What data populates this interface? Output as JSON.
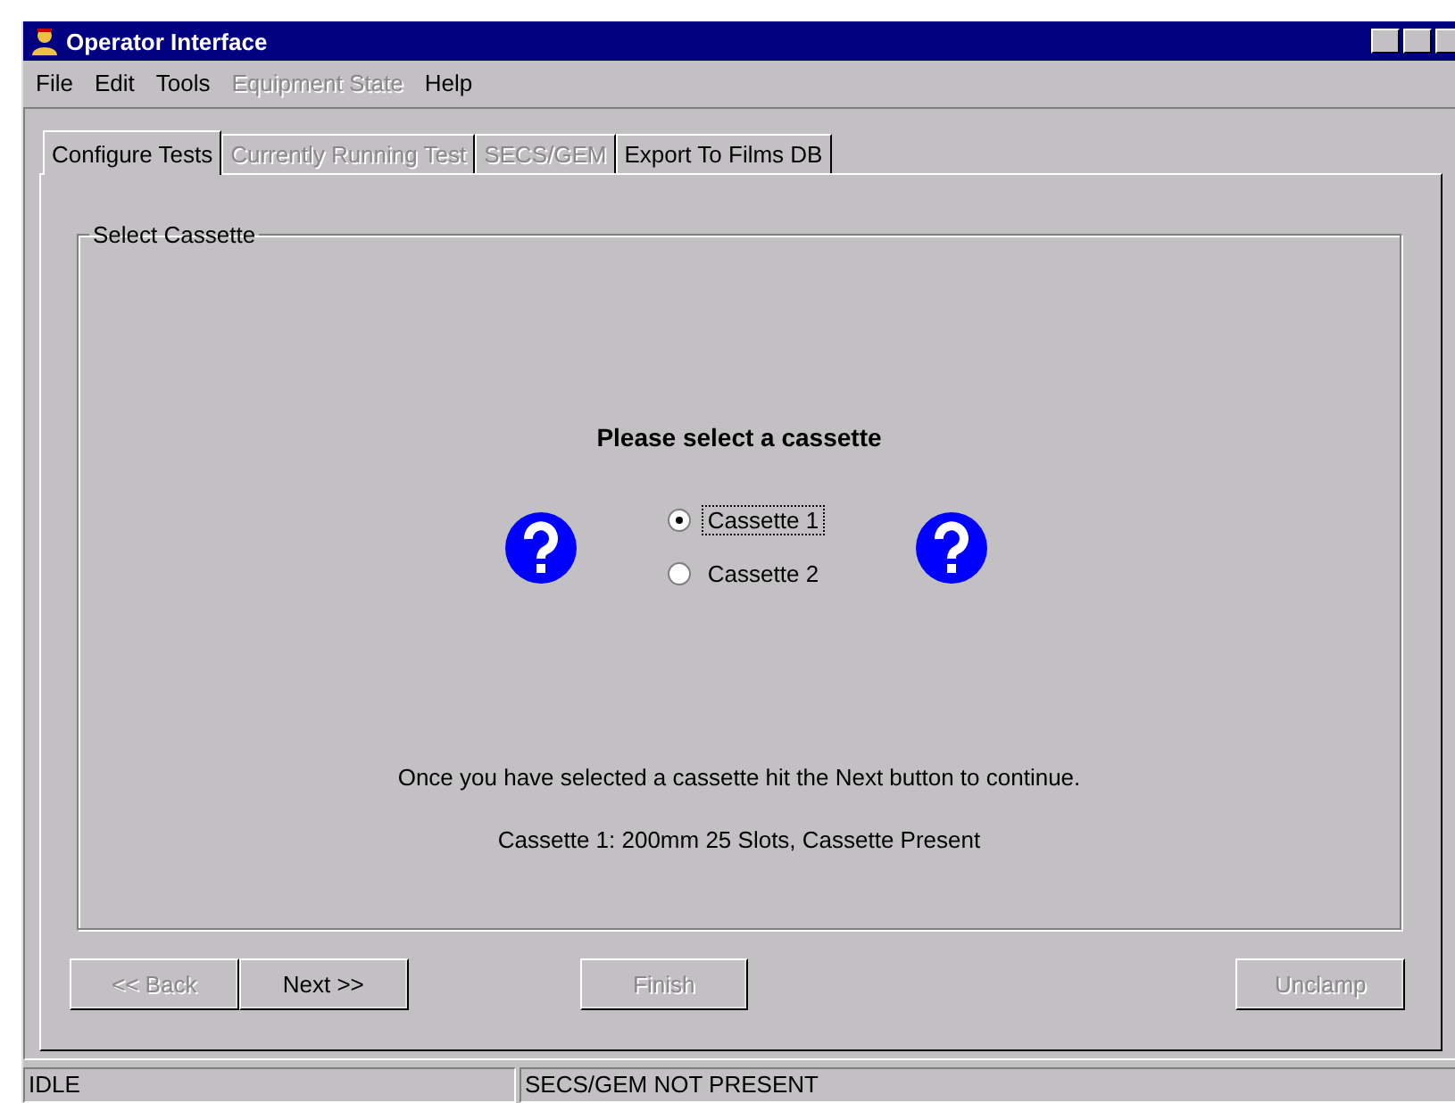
{
  "window": {
    "title": "Operator Interface"
  },
  "menu": [
    {
      "label": "File",
      "disabled": false
    },
    {
      "label": "Edit",
      "disabled": false
    },
    {
      "label": "Tools",
      "disabled": false
    },
    {
      "label": "Equipment State",
      "disabled": true
    },
    {
      "label": "Help",
      "disabled": false
    }
  ],
  "tabs": [
    {
      "label": "Configure Tests",
      "selected": true,
      "disabled": false
    },
    {
      "label": "Currently Running Test",
      "selected": false,
      "disabled": true
    },
    {
      "label": "SECS/GEM",
      "selected": false,
      "disabled": true
    },
    {
      "label": "Export To Films DB",
      "selected": false,
      "disabled": false
    }
  ],
  "group": {
    "title": "Select Cassette",
    "heading": "Please select a cassette",
    "options": [
      {
        "label": "Cassette 1",
        "selected": true
      },
      {
        "label": "Cassette 2",
        "selected": false
      }
    ],
    "instruction": "Once you have selected a cassette hit the Next button to continue.",
    "status": "Cassette 1: 200mm 25 Slots, Cassette Present"
  },
  "buttons": [
    {
      "label": "<< Back",
      "disabled": true
    },
    {
      "label": "Next >>",
      "disabled": false
    },
    {
      "label": "Finish",
      "disabled": true
    },
    {
      "label": "Unclamp",
      "disabled": true
    }
  ],
  "status_bar": [
    "IDLE",
    "SECS/GEM NOT PRESENT"
  ]
}
